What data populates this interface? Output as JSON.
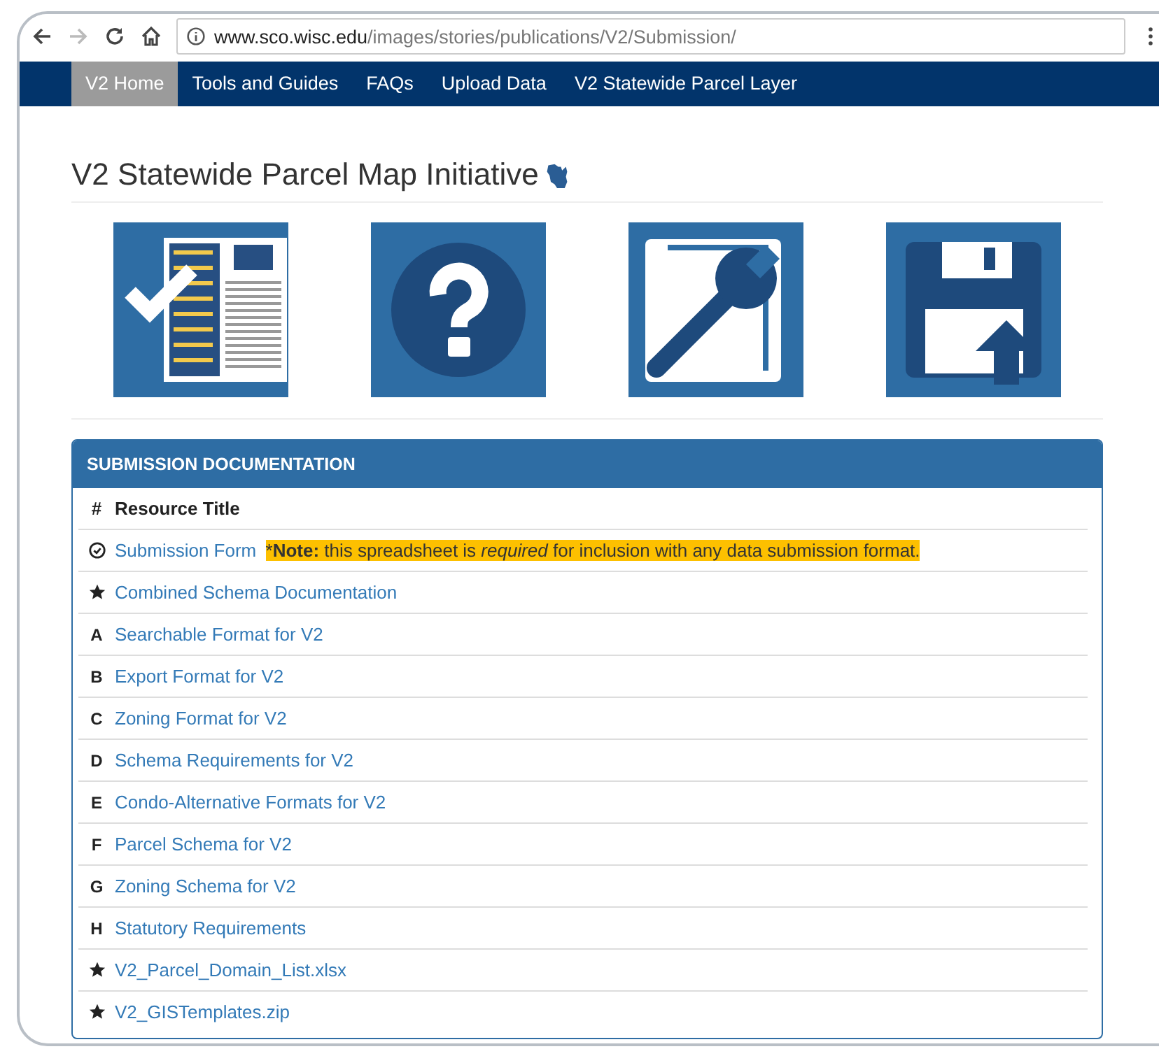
{
  "browser": {
    "url_host": "www.sco.wisc.edu",
    "url_path": "/images/stories/publications/V2/Submission/"
  },
  "nav": [
    {
      "label": "V2 Home",
      "selected": true
    },
    {
      "label": "Tools and Guides",
      "selected": false
    },
    {
      "label": "FAQs",
      "selected": false
    },
    {
      "label": "Upload Data",
      "selected": false
    },
    {
      "label": "V2 Statewide Parcel Layer",
      "selected": false
    }
  ],
  "page_title": "V2 Statewide Parcel Map Initiative",
  "tiles": [
    {
      "kind": "checklist"
    },
    {
      "kind": "question"
    },
    {
      "kind": "tools"
    },
    {
      "kind": "upload"
    }
  ],
  "panel": {
    "title": "SUBMISSION DOCUMENTATION",
    "columns": [
      "#",
      "Resource Title"
    ],
    "rows": [
      {
        "kind": "check",
        "title": "Submission Form",
        "note": {
          "mark": "*",
          "text": "**Note:** this spreadsheet is *required* for inclusion with any data submission format."
        }
      },
      {
        "kind": "star",
        "title": "Combined Schema Documentation"
      },
      {
        "kind": "letter",
        "marker": "A",
        "title": "Searchable Format for V2"
      },
      {
        "kind": "letter",
        "marker": "B",
        "title": "Export Format for V2"
      },
      {
        "kind": "letter",
        "marker": "C",
        "title": "Zoning Format for V2"
      },
      {
        "kind": "letter",
        "marker": "D",
        "title": "Schema Requirements for V2"
      },
      {
        "kind": "letter",
        "marker": "E",
        "title": "Condo-Alternative Formats for V2"
      },
      {
        "kind": "letter",
        "marker": "F",
        "title": "Parcel Schema for V2"
      },
      {
        "kind": "letter",
        "marker": "G",
        "title": "Zoning Schema for V2"
      },
      {
        "kind": "letter",
        "marker": "H",
        "title": "Statutory Requirements"
      },
      {
        "kind": "star",
        "title": "V2_Parcel_Domain_List.xlsx"
      },
      {
        "kind": "star",
        "title": "V2_GISTemplates.zip"
      }
    ]
  }
}
